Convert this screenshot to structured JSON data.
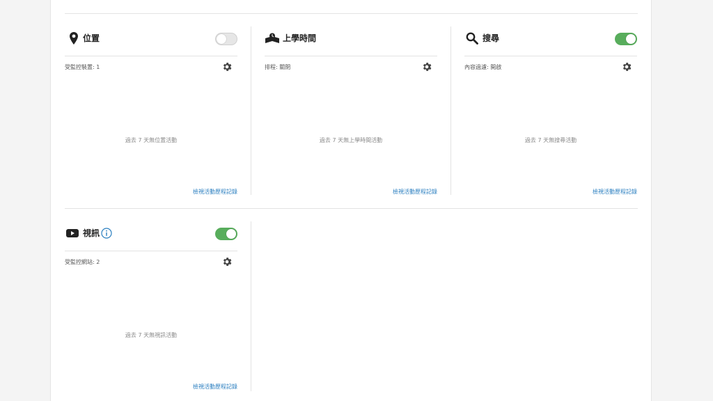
{
  "cards": [
    {
      "title": "位置",
      "icon": "location-pin-icon",
      "toggle_on": false,
      "status": "受監控裝置: 1",
      "empty_text": "過去 7 天無位置活動",
      "link": "檢視活動歷程記錄"
    },
    {
      "title": "上學時間",
      "icon": "school-time-icon",
      "toggle_on": null,
      "status": "排程: 關閉",
      "empty_text": "過去 7 天無上學時間活動",
      "link": "檢視活動歷程記錄"
    },
    {
      "title": "搜尋",
      "icon": "search-icon",
      "toggle_on": true,
      "status": "內容過濾: 開啟",
      "empty_text": "過去 7 天無搜尋活動",
      "link": "檢視活動歷程記錄"
    },
    {
      "title": "視訊",
      "icon": "youtube-icon",
      "has_info": true,
      "toggle_on": true,
      "status": "受監控網站: 2",
      "empty_text": "過去 7 天無視訊活動",
      "link": "檢視活動歷程記錄"
    }
  ],
  "colors": {
    "toggle_on": "#58ad5c",
    "link": "#2b7fc0",
    "info": "#2b7fc0"
  }
}
